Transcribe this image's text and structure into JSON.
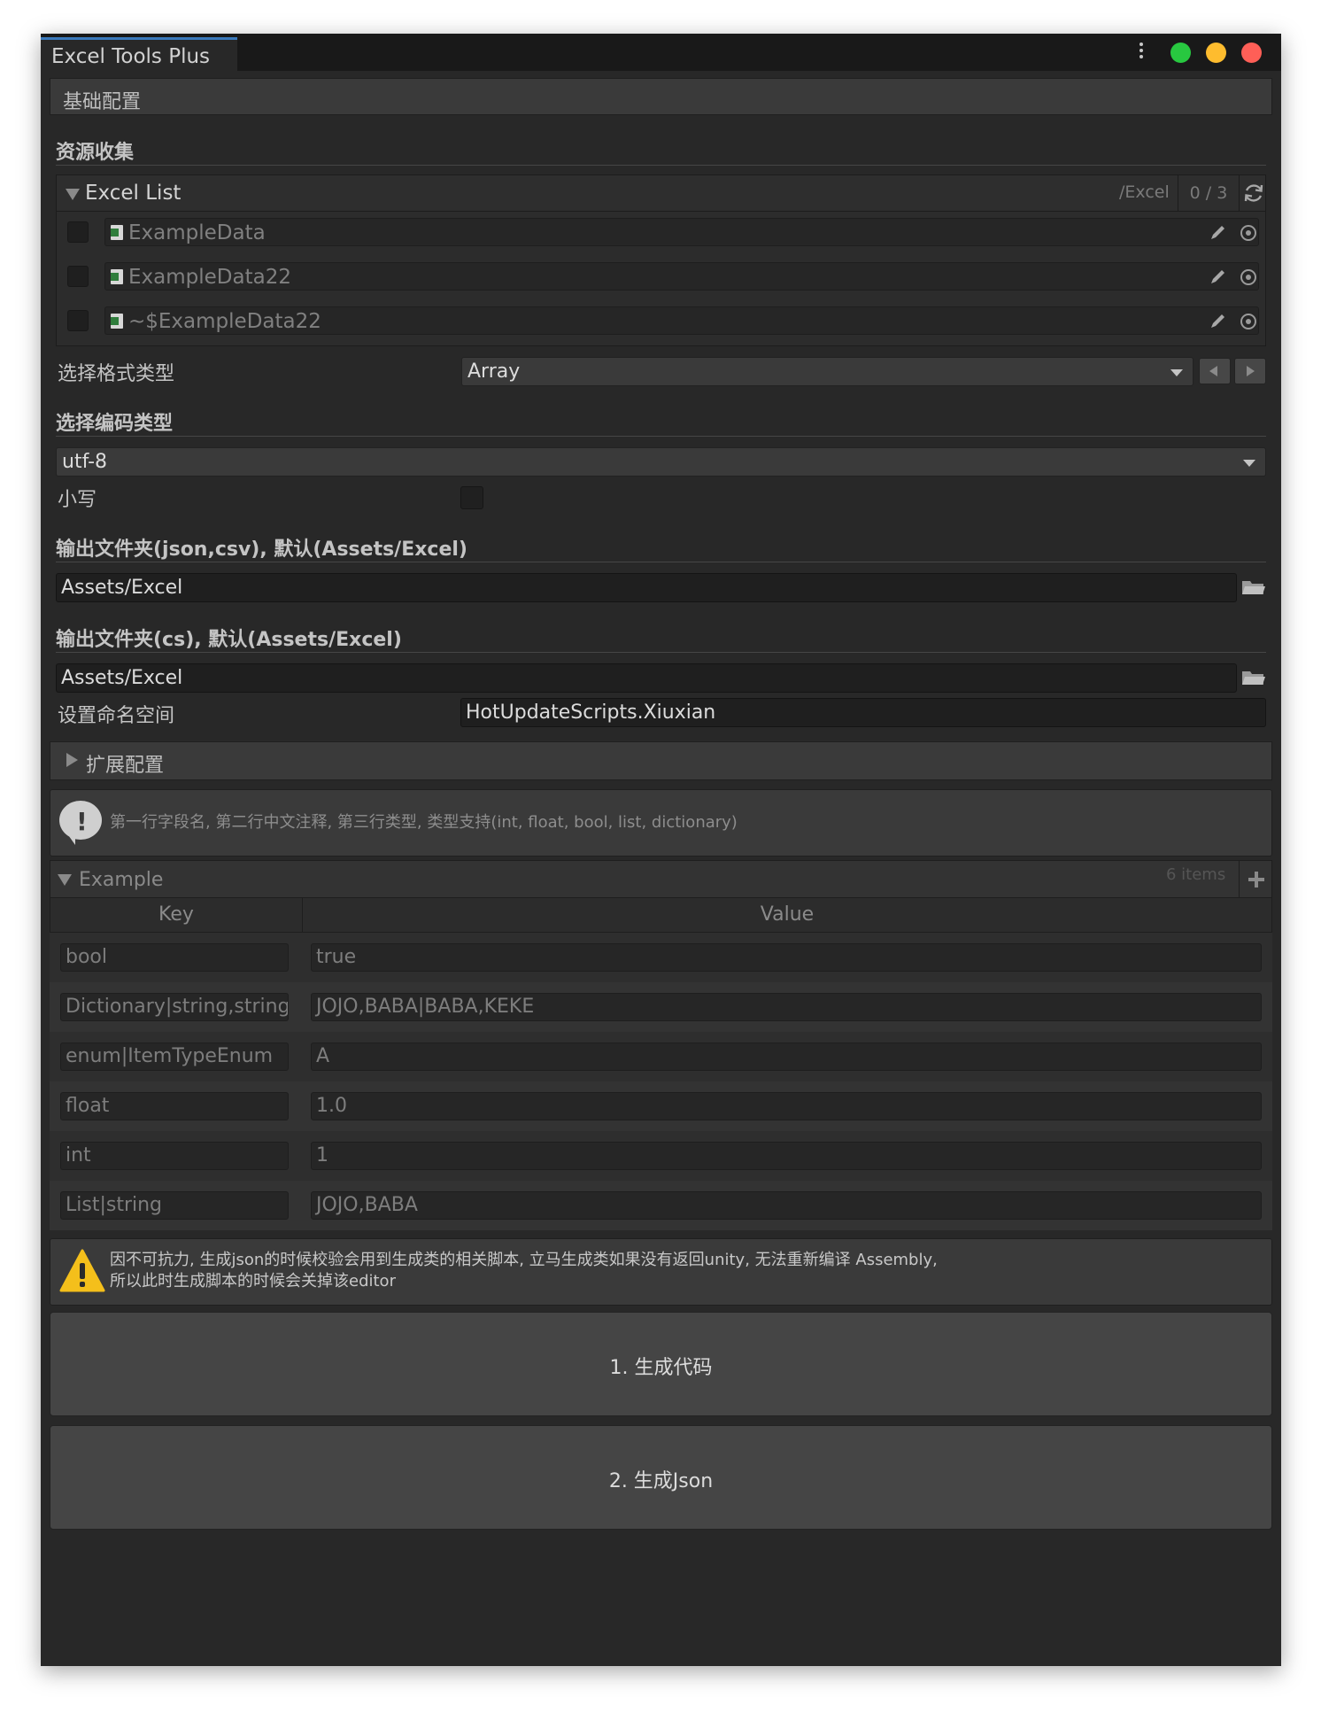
{
  "window": {
    "tab_title": "Excel Tools Plus",
    "traffic_lights": [
      "#28c840",
      "#febc2e",
      "#ff5f57"
    ]
  },
  "basic": {
    "header": "基础配置",
    "collect_heading": "资源收集"
  },
  "excel_list": {
    "title": "Excel List",
    "path": "/Excel",
    "count": "0 / 3",
    "items": [
      {
        "name": "ExampleData",
        "checked": false
      },
      {
        "name": "ExampleData22",
        "checked": false
      },
      {
        "name": "~$ExampleData22",
        "checked": false
      }
    ]
  },
  "format": {
    "label": "选择格式类型",
    "value": "Array"
  },
  "encoding": {
    "heading": "选择编码类型",
    "value": "utf-8"
  },
  "lowercase": {
    "label": "小写",
    "checked": false
  },
  "output_json": {
    "heading": "输出文件夹(json,csv), 默认(Assets/Excel)",
    "value": "Assets/Excel"
  },
  "output_cs": {
    "heading": "输出文件夹(cs), 默认(Assets/Excel)",
    "value": "Assets/Excel"
  },
  "namespace": {
    "label": "设置命名空间",
    "value": "HotUpdateScripts.Xiuxian"
  },
  "extend": {
    "label": "扩展配置"
  },
  "info": {
    "text": "第一行字段名, 第二行中文注释, 第三行类型, 类型支持(int, float, bool, list, dictionary)"
  },
  "example": {
    "title": "Example",
    "count": "6 items",
    "key_header": "Key",
    "value_header": "Value",
    "rows": [
      {
        "key": "bool",
        "value": "true"
      },
      {
        "key": "Dictionary|string,string",
        "value": "JOJO,BABA|BABA,KEKE"
      },
      {
        "key": "enum|ItemTypeEnum",
        "value": "A"
      },
      {
        "key": "float",
        "value": "1.0"
      },
      {
        "key": "int",
        "value": "1"
      },
      {
        "key": "List|string",
        "value": "JOJO,BABA"
      }
    ]
  },
  "warning": {
    "line1": "因不可抗力, 生成json的时候校验会用到生成类的相关脚本, 立马生成类如果没有返回unity, 无法重新编译 Assembly,",
    "line2": "所以此时生成脚本的时候会关掉该editor"
  },
  "buttons": {
    "gen_code": "1. 生成代码",
    "gen_json": "2. 生成Json"
  }
}
